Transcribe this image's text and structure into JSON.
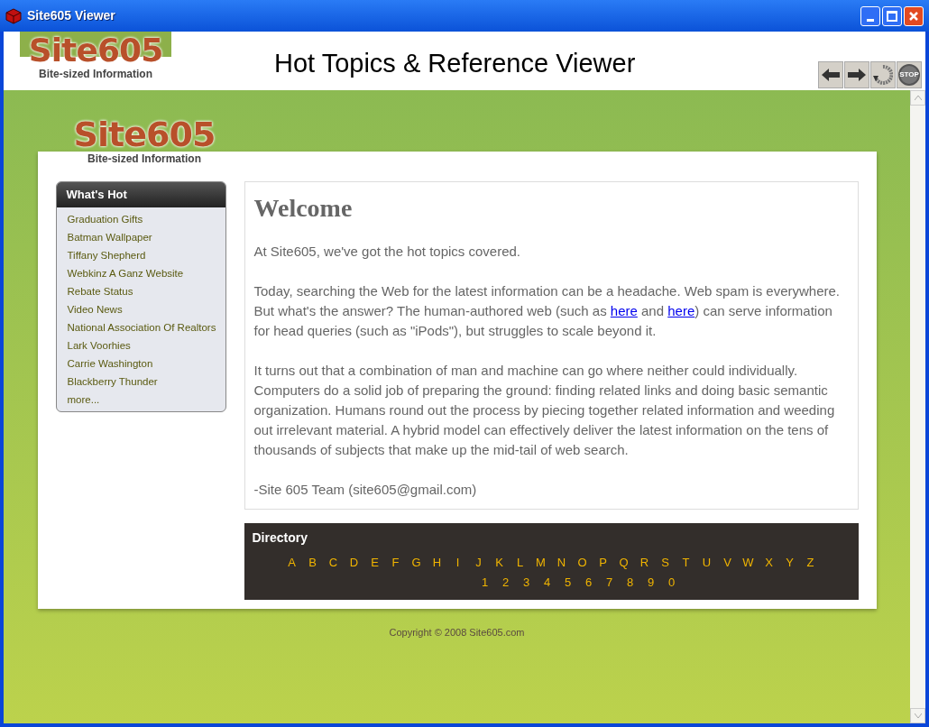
{
  "window": {
    "title": "Site605 Viewer"
  },
  "header": {
    "logo": {
      "name": "Site605",
      "tagline": "Bite-sized Information"
    },
    "title": "Hot Topics & Reference Viewer",
    "toolbar": [
      {
        "kind": "back"
      },
      {
        "kind": "forward"
      },
      {
        "kind": "refresh"
      },
      {
        "kind": "stop",
        "label": "STOP"
      }
    ]
  },
  "page": {
    "logo": {
      "name": "Site605",
      "tagline": "Bite-sized Information"
    },
    "sidebar": {
      "title": "What's Hot",
      "items": [
        "Graduation Gifts",
        "Batman Wallpaper",
        "Tiffany Shepherd",
        "Webkinz A Ganz Website",
        "Rebate Status",
        "Video News",
        "National Association Of Realtors",
        "Lark Voorhies",
        "Carrie Washington",
        "Blackberry Thunder",
        "more..."
      ]
    },
    "content": {
      "heading": "Welcome",
      "paragraphs": [
        [
          {
            "kind": "text",
            "text": "At Site605, we've got the hot topics covered."
          }
        ],
        [
          {
            "kind": "text",
            "text": "Today, searching the Web for the latest information can be a headache. Web spam is everywhere. But what's the answer? The human-authored web (such as "
          },
          {
            "kind": "link",
            "text": "here"
          },
          {
            "kind": "text",
            "text": " and "
          },
          {
            "kind": "link",
            "text": "here"
          },
          {
            "kind": "text",
            "text": ") can serve information for head queries (such as \"iPods\"), but struggles to scale beyond it."
          }
        ],
        [
          {
            "kind": "text",
            "text": "It turns out that a combination of man and machine can go where neither could individually. Computers do a solid job of preparing the ground: finding related links and doing basic semantic organization. Humans round out the process by piecing together related information and weeding out irrelevant material. A hybrid model can effectively deliver the latest information on the tens of thousands of subjects that make up the mid-tail of web search."
          }
        ],
        [
          {
            "kind": "text",
            "text": "-Site 605 Team (site605@gmail.com)"
          }
        ]
      ]
    },
    "directory": {
      "title": "Directory",
      "letters": [
        "A",
        "B",
        "C",
        "D",
        "E",
        "F",
        "G",
        "H",
        "I",
        "J",
        "K",
        "L",
        "M",
        "N",
        "O",
        "P",
        "Q",
        "R",
        "S",
        "T",
        "U",
        "V",
        "W",
        "X",
        "Y",
        "Z"
      ],
      "digits": [
        "1",
        "2",
        "3",
        "4",
        "5",
        "6",
        "7",
        "8",
        "9",
        "0"
      ]
    },
    "copyright": "Copyright © 2008 Site605.com"
  }
}
